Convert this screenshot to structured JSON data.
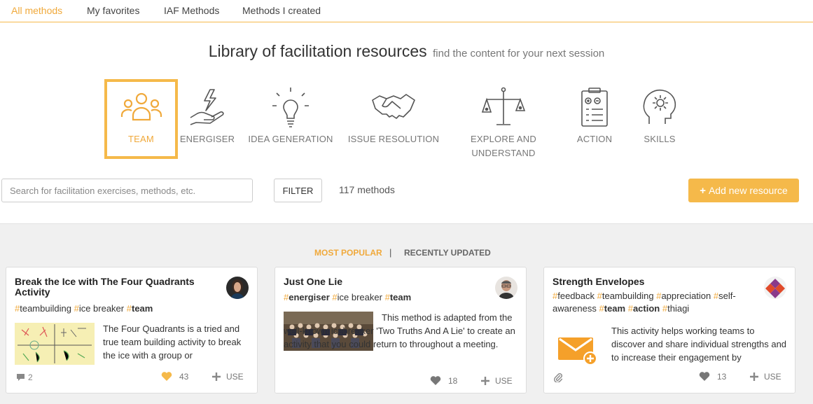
{
  "tabs": [
    "All methods",
    "My favorites",
    "IAF Methods",
    "Methods I created"
  ],
  "heading": {
    "title": "Library of facilitation resources",
    "subtitle": "find the content for your next session"
  },
  "categories": [
    {
      "label": "TEAM",
      "icon": "team-icon"
    },
    {
      "label": "ENERGISER",
      "icon": "energiser-icon"
    },
    {
      "label": "IDEA GENERATION",
      "icon": "lightbulb-icon"
    },
    {
      "label": "ISSUE RESOLUTION",
      "icon": "handshake-icon"
    },
    {
      "label": "EXPLORE AND UNDERSTAND",
      "icon": "scales-icon"
    },
    {
      "label": "ACTION",
      "icon": "clipboard-icon"
    },
    {
      "label": "SKILLS",
      "icon": "head-gear-icon"
    }
  ],
  "search": {
    "placeholder": "Search for facilitation exercises, methods, etc."
  },
  "filter_label": "FILTER",
  "method_count": "117 methods",
  "add_label": "Add new resource",
  "sort": {
    "popular": "MOST POPULAR",
    "separator": "|",
    "recent": "RECENTLY UPDATED"
  },
  "cards": [
    {
      "title": "Break the Ice with The Four Quadrants Activity",
      "tags": [
        "teambuilding",
        "ice breaker",
        "team"
      ],
      "description": "The Four Quadrants is a tried and true team building activity to break the ice with a group or",
      "comments": "2",
      "likes": "43",
      "use": "USE"
    },
    {
      "title": "Just One Lie",
      "tags": [
        "energiser",
        "ice breaker",
        "team"
      ],
      "description": "This method is adapted from the well-known icebreaker 'Two Truths And A Lie' to create an activity that you could return to throughout a meeting.",
      "likes": "18",
      "use": "USE"
    },
    {
      "title": "Strength Envelopes",
      "tags": [
        "feedback",
        "teambuilding",
        "appreciation",
        "self-awareness",
        "team",
        "action",
        "thiagi"
      ],
      "description": "This activity helps working teams to discover and share individual strengths and to increase their engagement by",
      "likes": "13",
      "use": "USE"
    }
  ],
  "colors": {
    "accent": "#f5b94a",
    "accent_text": "#f0a93b"
  }
}
